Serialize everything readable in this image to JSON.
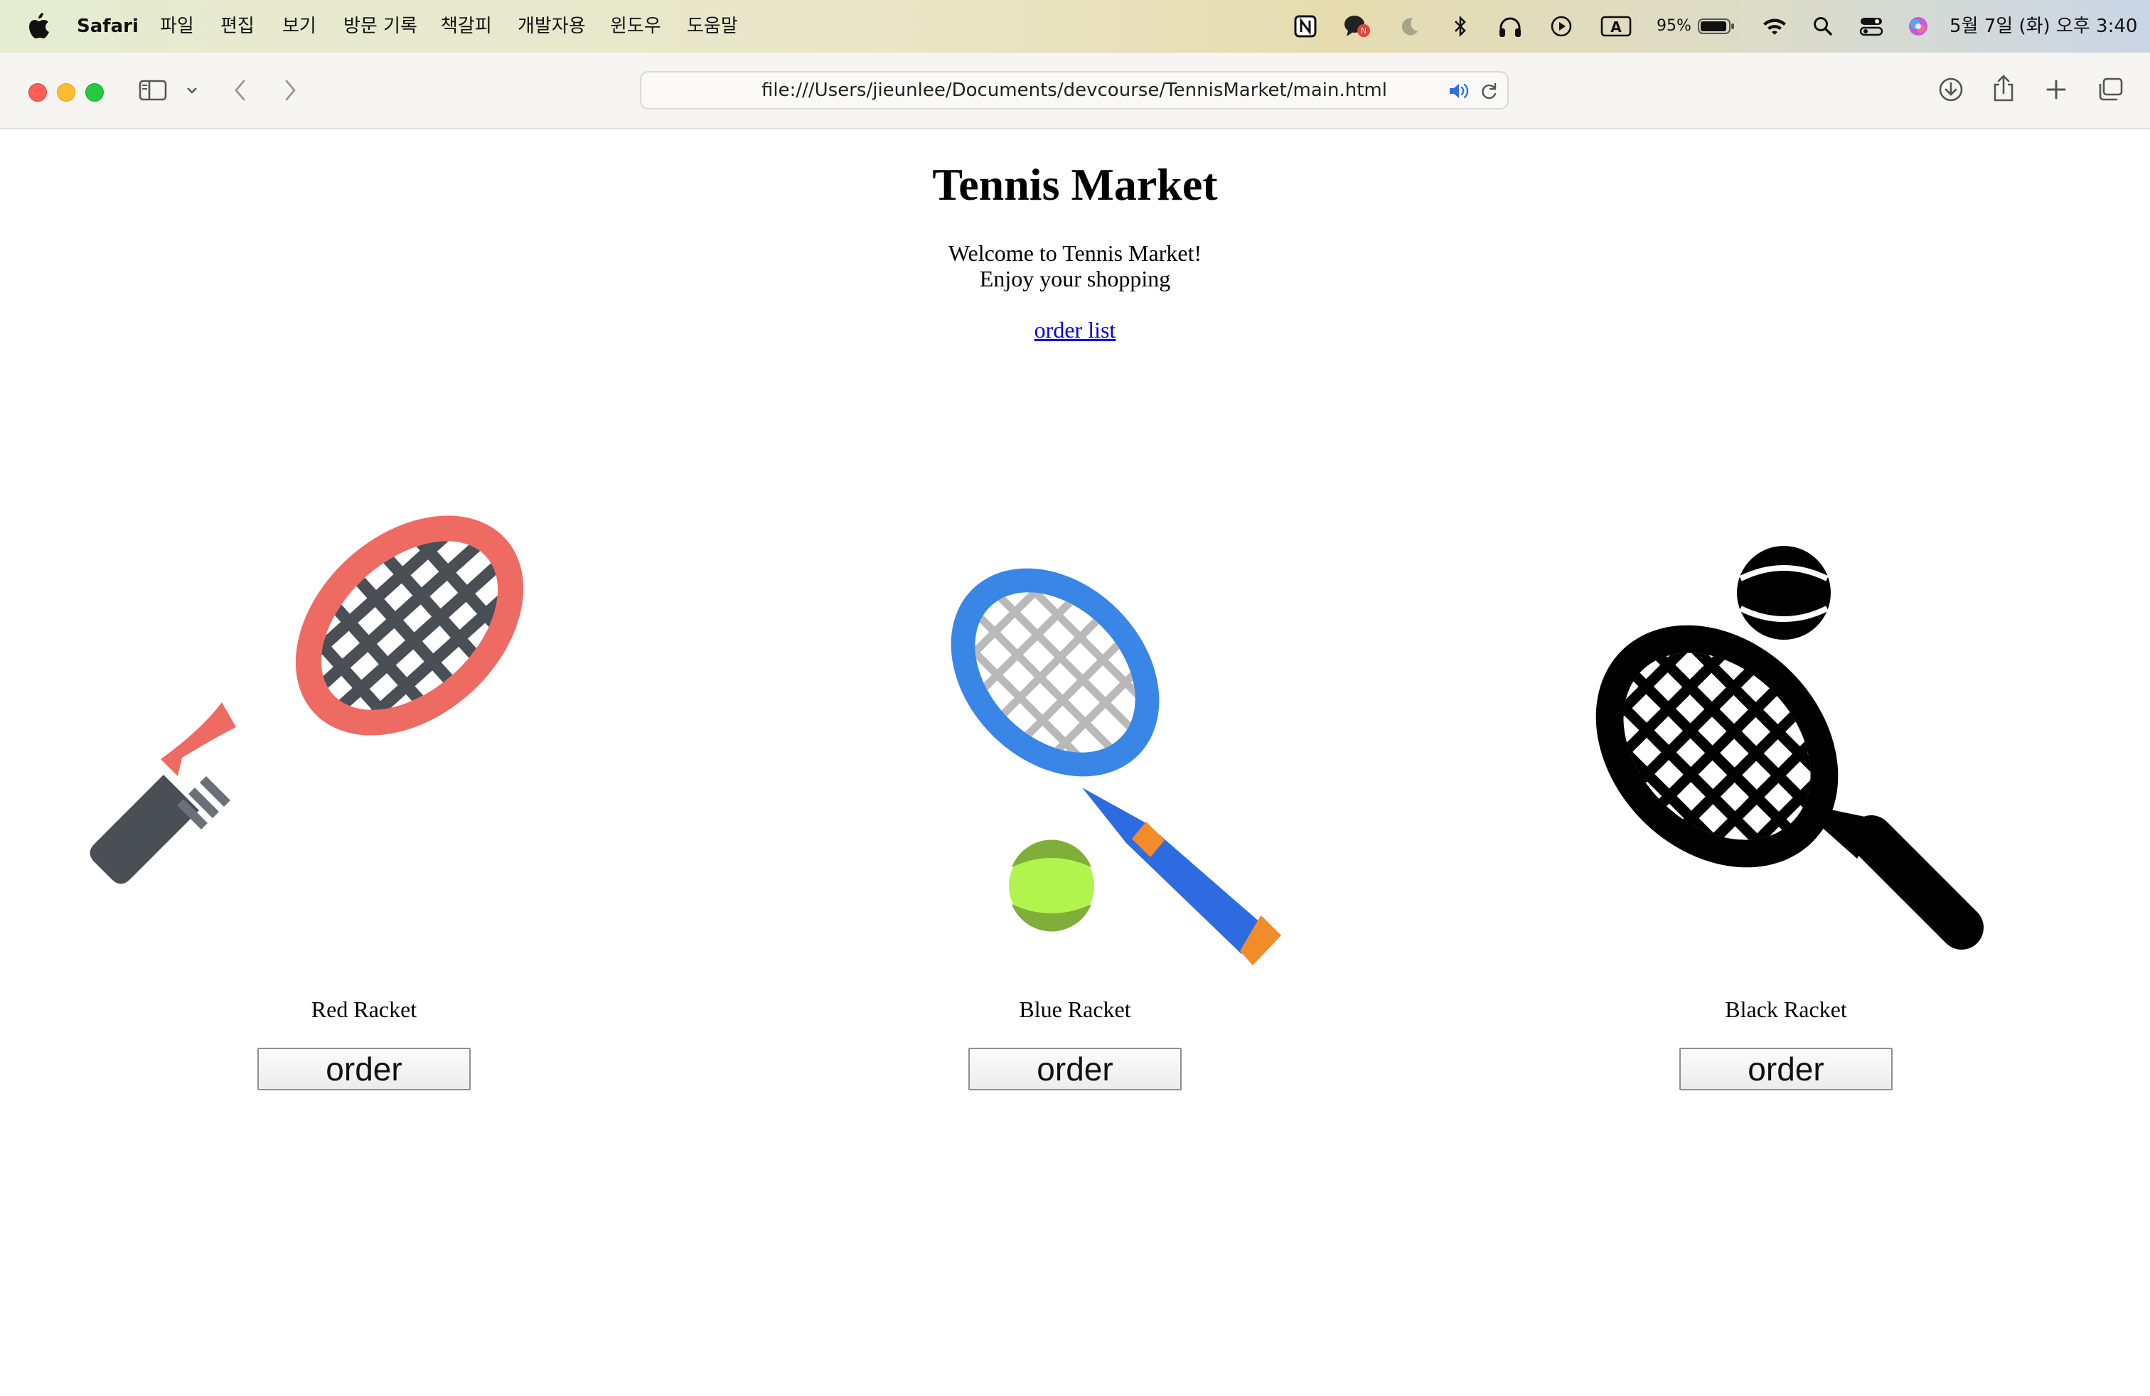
{
  "menubar": {
    "app_name": "Safari",
    "items": [
      "파일",
      "편집",
      "보기",
      "방문 기록",
      "책갈피",
      "개발자용",
      "윈도우",
      "도움말"
    ],
    "battery": "95%",
    "datetime": "5월 7일 (화) 오후 3:40",
    "icons": [
      "apple-logo",
      "notion-icon",
      "messenger-icon",
      "moon-icon",
      "bluetooth-icon",
      "headphones-icon",
      "play-icon",
      "input-method-icon",
      "battery-icon",
      "wifi-icon",
      "spotlight-search-icon",
      "control-center-icon",
      "siri-icon"
    ]
  },
  "toolbar": {
    "url": "file:///Users/jieunlee/Documents/devcourse/TennisMarket/main.html",
    "icons": [
      "sidebar-icon",
      "chevron-down-icon",
      "back-icon",
      "forward-icon",
      "speaker-icon",
      "reload-icon",
      "download-icon",
      "share-icon",
      "new-tab-icon",
      "tabs-overview-icon"
    ],
    "traffic_lights": {
      "close": "#ff5f57",
      "minimize": "#febc2e",
      "zoom": "#28c840"
    }
  },
  "page": {
    "title": "Tennis Market",
    "welcome_line1": "Welcome to Tennis Market!",
    "welcome_line2": "Enjoy your shopping",
    "order_list_link": "order list",
    "products": [
      {
        "name": "Red Racket",
        "button": "order",
        "color": "#ee6b63"
      },
      {
        "name": "Blue Racket",
        "button": "order",
        "color": "#3a86e6"
      },
      {
        "name": "Black Racket",
        "button": "order",
        "color": "#000000"
      }
    ]
  }
}
